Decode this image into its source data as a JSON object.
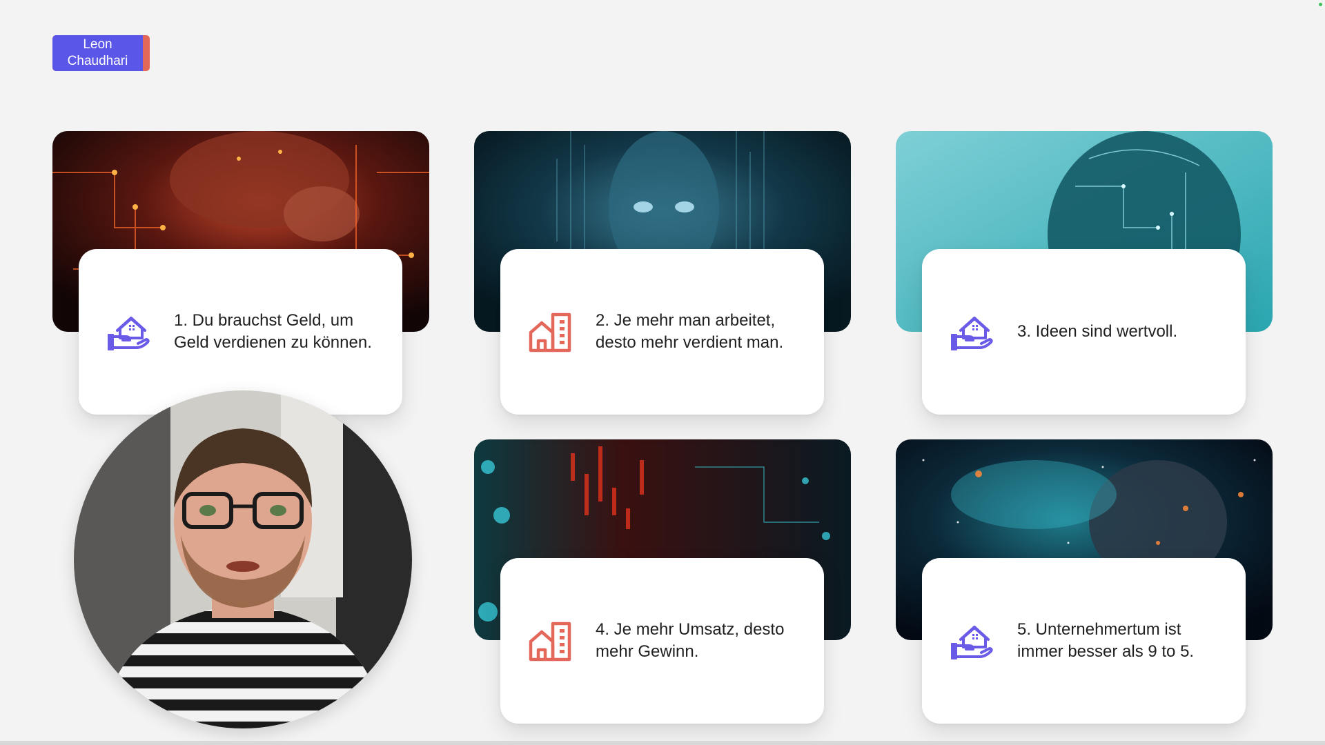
{
  "brand": {
    "name": "Leon Chaudhari"
  },
  "colors": {
    "background": "#f3f3f3",
    "brand_purple": "#5a56e8",
    "brand_coral": "#e4685a",
    "icon_purple": "#6a5ae8",
    "icon_coral": "#e4685a"
  },
  "cards": [
    {
      "icon": "hand-house-icon",
      "text": "1. Du brauchst Geld, um Geld verdienen zu können."
    },
    {
      "icon": "buildings-icon",
      "text": "2. Je mehr man arbeitet, desto mehr verdient man."
    },
    {
      "icon": "hand-house-icon",
      "text": "3. Ideen sind wertvoll."
    },
    {
      "icon": "buildings-icon",
      "text": "4. Je mehr Umsatz, desto mehr Gewinn."
    },
    {
      "icon": "hand-house-icon",
      "text": "5. Unternehmertum ist immer besser als 9 to 5."
    }
  ]
}
